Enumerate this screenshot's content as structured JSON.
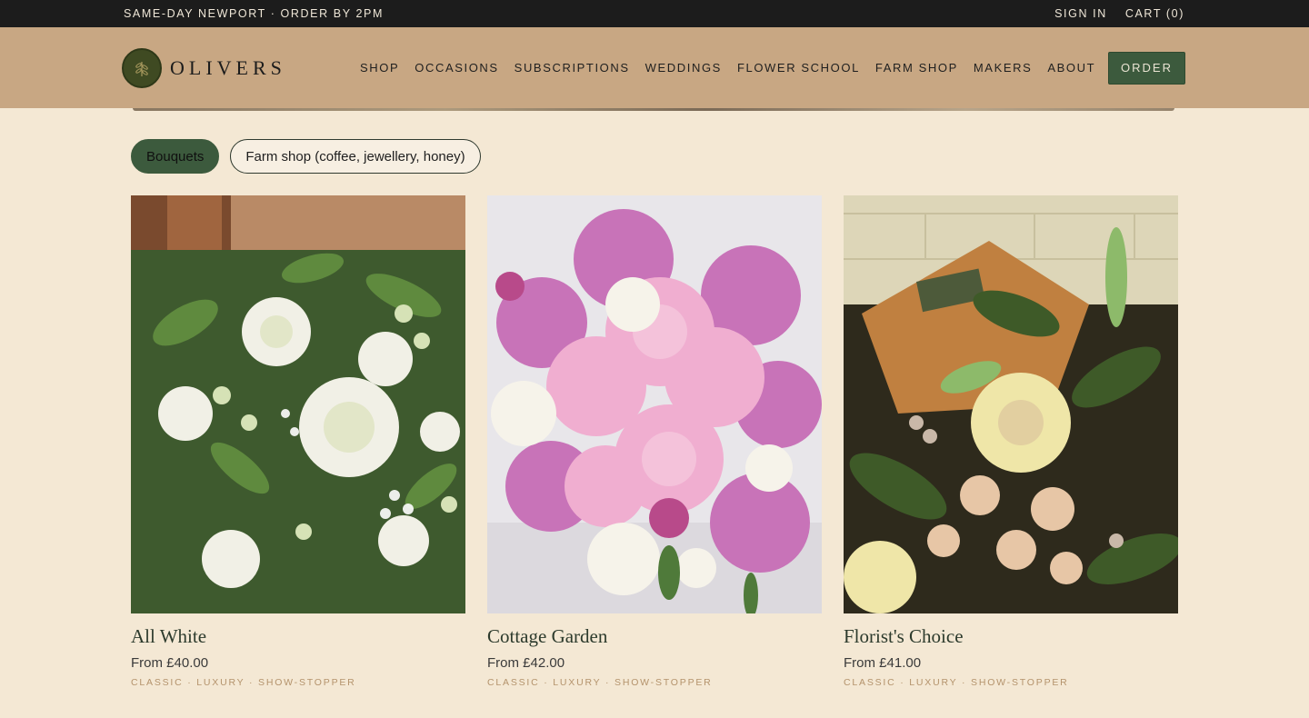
{
  "topbar": {
    "announcement": "SAME-DAY NEWPORT · ORDER BY 2PM",
    "sign_in": "SIGN IN",
    "cart": "CART (0)"
  },
  "header": {
    "logo_text": "OLIVERS",
    "nav": [
      "SHOP",
      "OCCASIONS",
      "SUBSCRIPTIONS",
      "WEDDINGS",
      "FLOWER SCHOOL",
      "FARM SHOP",
      "MAKERS",
      "ABOUT"
    ],
    "order_label": "ORDER"
  },
  "filters": {
    "active": "Bouquets",
    "other": "Farm shop (coffee, jewellery, honey)"
  },
  "products": [
    {
      "name": "All White",
      "price": "From £40.00",
      "tags": "CLASSIC · LUXURY · SHOW-STOPPER",
      "image": "white-roses-bouquet"
    },
    {
      "name": "Cottage Garden",
      "price": "From £42.00",
      "tags": "CLASSIC · LUXURY · SHOW-STOPPER",
      "image": "pink-peony-bouquet"
    },
    {
      "name": "Florist's Choice",
      "price": "From £41.00",
      "tags": "CLASSIC · LUXURY · SHOW-STOPPER",
      "image": "cream-rose-bouquet"
    }
  ],
  "colors": {
    "accent_green": "#3c5a3d",
    "header_tan": "#c8a783",
    "page_bg": "#f4e8d4",
    "topbar": "#1c1c1c",
    "tag_color": "#b4936c"
  }
}
